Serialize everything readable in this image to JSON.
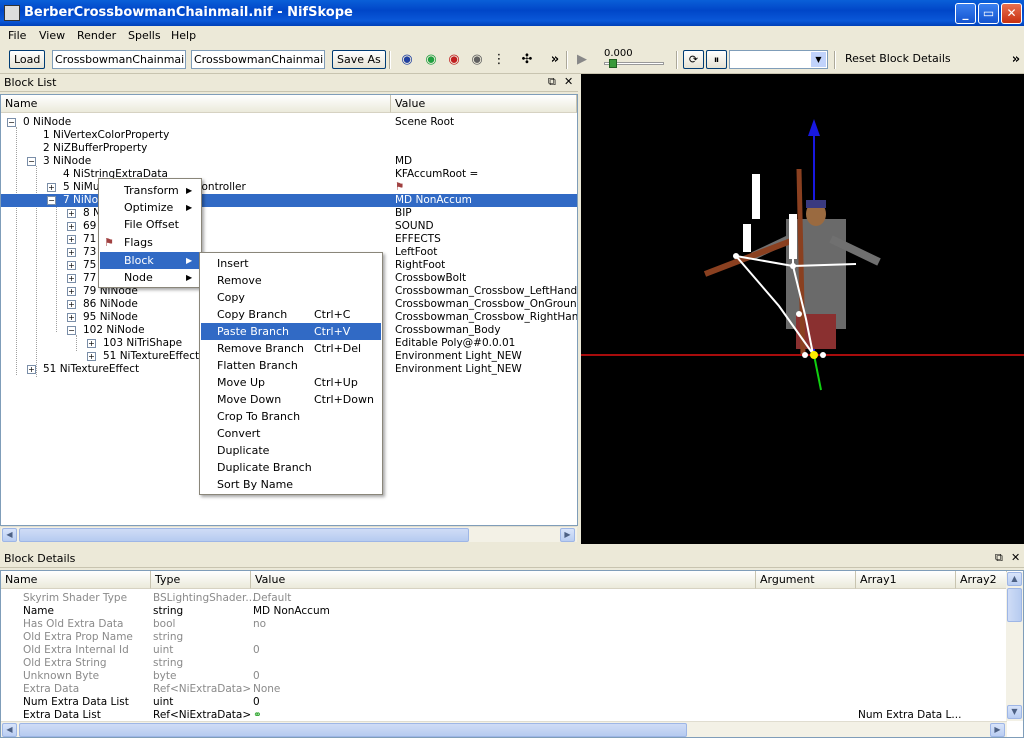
{
  "window": {
    "title": "BerberCrossbowmanChainmail.nif - NifSkope"
  },
  "menu": [
    "File",
    "View",
    "Render",
    "Spells",
    "Help"
  ],
  "toolbar": {
    "load_label": "Load",
    "load_path": "CrossbowmanChainmail.nif",
    "save_path": "CrossbowmanChainmail.nif",
    "save_as_label": "Save As",
    "time_value": "0.000",
    "reset_label": "Reset Block Details",
    "overflow": "»"
  },
  "block_list": {
    "title": "Block List",
    "col_name": "Name",
    "col_value": "Value",
    "rows": [
      {
        "name": "0 NiNode",
        "value": "Scene Root"
      },
      {
        "name": "1 NiVertexColorProperty",
        "value": ""
      },
      {
        "name": "2 NiZBufferProperty",
        "value": ""
      },
      {
        "name": "3 NiNode",
        "value": "MD"
      },
      {
        "name": "4 NiStringExtraData",
        "value": "KFAccumRoot ="
      },
      {
        "name": "5 NiMultiTargetTransformController",
        "value": ""
      },
      {
        "name": "7 NiNode",
        "value": "MD NonAccum"
      },
      {
        "name": "8 NiNode",
        "value": "BIP"
      },
      {
        "name": "69 NiNode",
        "value": "SOUND"
      },
      {
        "name": "71 NiNode",
        "value": "EFFECTS"
      },
      {
        "name": "73 NiNode",
        "value": "LeftFoot"
      },
      {
        "name": "75 NiNode",
        "value": "RightFoot"
      },
      {
        "name": "77 NiNode",
        "value": "CrossbowBolt"
      },
      {
        "name": "79 NiNode",
        "value": "Crossbowman_Crossbow_LeftHand"
      },
      {
        "name": "86 NiNode",
        "value": "Crossbowman_Crossbow_OnGround"
      },
      {
        "name": "95 NiNode",
        "value": "Crossbowman_Crossbow_RightHand"
      },
      {
        "name": "102 NiNode",
        "value": "Crossbowman_Body"
      },
      {
        "name": "103 NiTriShape",
        "value": "Editable Poly@#0.0.01"
      },
      {
        "name": "51 NiTextureEffect",
        "value": "Environment Light_NEW"
      },
      {
        "name": "51 NiTextureEffect",
        "value": "Environment Light_NEW"
      }
    ]
  },
  "context_menu": {
    "items": [
      "Transform",
      "Optimize",
      "File Offset",
      "Flags",
      "Block",
      "Node"
    ]
  },
  "block_submenu": {
    "items": [
      {
        "label": "Insert",
        "shortcut": ""
      },
      {
        "label": "Remove",
        "shortcut": ""
      },
      {
        "label": "Copy",
        "shortcut": ""
      },
      {
        "label": "Copy Branch",
        "shortcut": "Ctrl+C"
      },
      {
        "label": "Paste Branch",
        "shortcut": "Ctrl+V"
      },
      {
        "label": "Remove Branch",
        "shortcut": "Ctrl+Del"
      },
      {
        "label": "Flatten Branch",
        "shortcut": ""
      },
      {
        "label": "Move Up",
        "shortcut": "Ctrl+Up"
      },
      {
        "label": "Move Down",
        "shortcut": "Ctrl+Down"
      },
      {
        "label": "Crop To Branch",
        "shortcut": ""
      },
      {
        "label": "Convert",
        "shortcut": ""
      },
      {
        "label": "Duplicate",
        "shortcut": ""
      },
      {
        "label": "Duplicate Branch",
        "shortcut": ""
      },
      {
        "label": "Sort By Name",
        "shortcut": ""
      }
    ]
  },
  "block_details": {
    "title": "Block Details",
    "columns": [
      "Name",
      "Type",
      "Value",
      "Argument",
      "Array1",
      "Array2"
    ],
    "rows": [
      {
        "name": "Skyrim Shader Type",
        "type": "BSLightingShader...",
        "value": "Default",
        "array1": ""
      },
      {
        "name": "Name",
        "type": "string",
        "value": "MD NonAccum",
        "array1": ""
      },
      {
        "name": "Has Old Extra Data",
        "type": "bool",
        "value": "no",
        "array1": ""
      },
      {
        "name": "Old Extra Prop Name",
        "type": "string",
        "value": "",
        "array1": ""
      },
      {
        "name": "Old Extra Internal Id",
        "type": "uint",
        "value": "0",
        "array1": ""
      },
      {
        "name": "Old Extra String",
        "type": "string",
        "value": "",
        "array1": ""
      },
      {
        "name": "Unknown Byte",
        "type": "byte",
        "value": "0",
        "array1": ""
      },
      {
        "name": "Extra Data",
        "type": "Ref<NiExtraData>",
        "value": "None",
        "array1": ""
      },
      {
        "name": "Num Extra Data List",
        "type": "uint",
        "value": "0",
        "array1": ""
      },
      {
        "name": "Extra Data List",
        "type": "Ref<NiExtraData>",
        "value": "",
        "array1": "Num Extra Data L..."
      }
    ]
  },
  "colors": {
    "selection": "#316ac5",
    "titlebar": "#0a58d8",
    "viewport_bg": "#000000"
  }
}
